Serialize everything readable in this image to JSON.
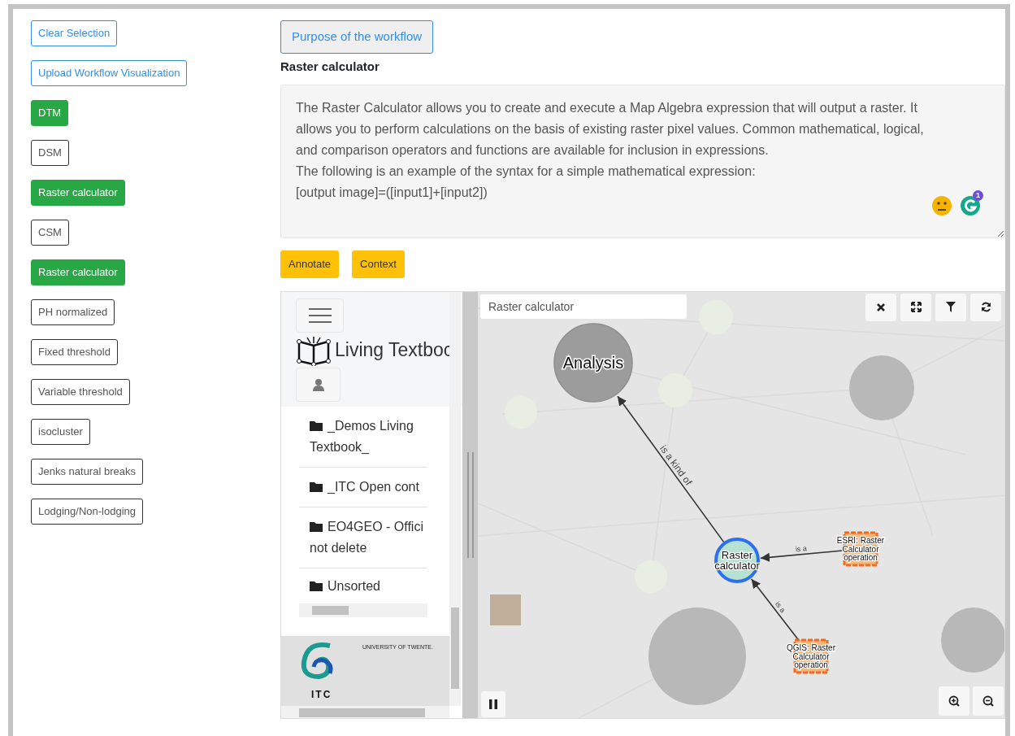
{
  "sidebar": {
    "actions": [
      {
        "label": "Clear Selection"
      },
      {
        "label": "Upload Workflow Visualization"
      }
    ],
    "steps": [
      {
        "label": "DTM",
        "selected": true
      },
      {
        "label": "DSM",
        "selected": false
      },
      {
        "label": "Raster calculator",
        "selected": true
      },
      {
        "label": "CSM",
        "selected": false
      },
      {
        "label": "Raster calculator",
        "selected": true
      },
      {
        "label": "PH normalized",
        "selected": false
      },
      {
        "label": "Fixed threshold",
        "selected": false
      },
      {
        "label": "Variable threshold",
        "selected": false
      },
      {
        "label": "isocluster",
        "selected": false
      },
      {
        "label": "Jenks natural breaks",
        "selected": false
      },
      {
        "label": "Lodging/Non-lodging",
        "selected": false
      }
    ]
  },
  "main": {
    "purpose_button": "Purpose of the workflow",
    "title": "Raster calculator",
    "description": [
      "The Raster Calculator allows you to create and execute a Map Algebra expression that will output a raster. It allows you to perform calculations on the basis of existing raster pixel values. Common mathematical, logical, and comparison operators and functions are available for inclusion in expressions.",
      "The following is an example of the syntax for a simple mathematical expression:",
      "[output image]=([input1]+[input2])"
    ],
    "grammar_count": "1",
    "actions": [
      "Annotate",
      "Context"
    ]
  },
  "browser_panel": {
    "brand": "Living Textboc",
    "folders": [
      {
        "lines": [
          "_Demos Living",
          "Textbook_"
        ]
      },
      {
        "lines": [
          "_ITC Open cont"
        ]
      },
      {
        "lines": [
          "EO4GEO - Offici",
          "not delete"
        ]
      },
      {
        "lines": [
          "Unsorted"
        ]
      }
    ],
    "footer_text": "UNIVERSITY OF TWENTE.",
    "logo_text": "ITC"
  },
  "graph": {
    "search": {
      "value": "Raster calculator"
    },
    "nodes": [
      {
        "kind": "category",
        "lines": [
          "Analysis"
        ]
      },
      {
        "kind": "concept",
        "lines": [
          "Raster",
          "calculator"
        ],
        "selected": true
      },
      {
        "kind": "operation",
        "lines": [
          "ESRI: Raster",
          "Calculator",
          "operation"
        ]
      },
      {
        "kind": "operation",
        "lines": [
          "QGIS: Raster",
          "Calculator",
          "operation"
        ]
      }
    ],
    "edges": [
      {
        "label": "is a kind of"
      },
      {
        "label": "is a"
      },
      {
        "label": "is a"
      }
    ]
  }
}
